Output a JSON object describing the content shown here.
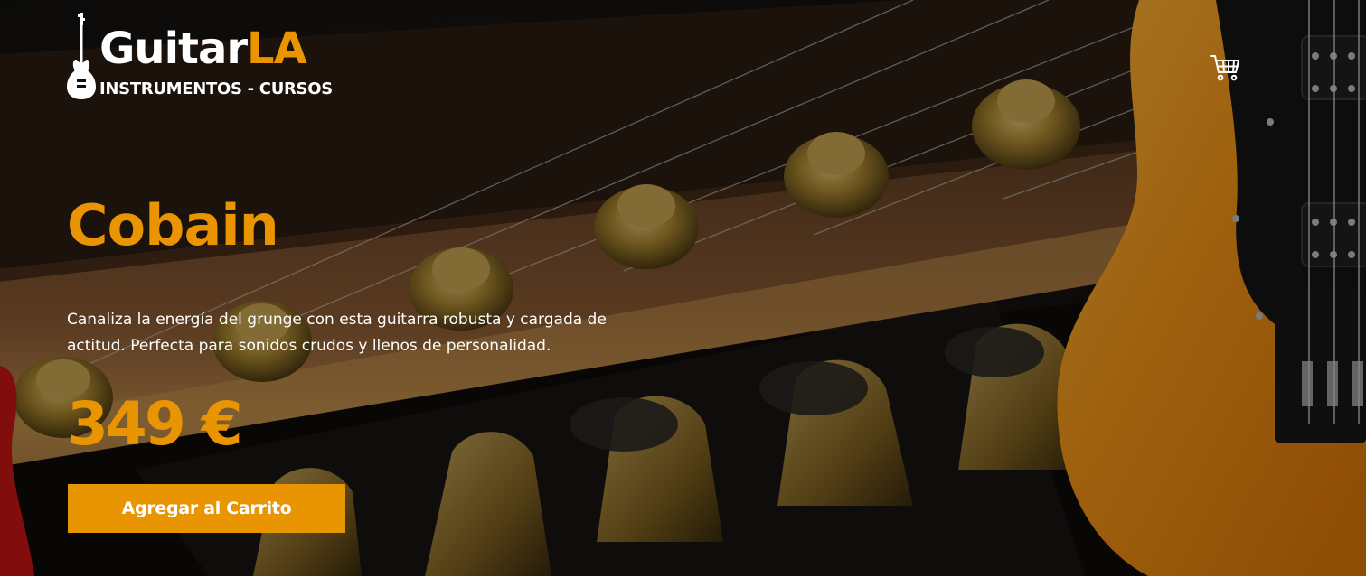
{
  "header": {
    "logo": {
      "title_main": "Guitar",
      "title_accent": "LA",
      "subtitle": "INSTRUMENTOS - CURSOS",
      "icon": "guitar-icon"
    },
    "cart": {
      "icon": "shopping-cart-icon"
    }
  },
  "hero": {
    "background": "guitar-headstock-photo",
    "product": {
      "name": "Cobain",
      "description": "Canaliza la energía del grunge con esta guitarra robusta y cargada de actitud. Perfecta para sonidos crudos y llenos de personalidad.",
      "price": "349 €",
      "button_label": "Agregar al Carrito"
    }
  },
  "colors": {
    "accent": "#e99401",
    "text": "#ffffff",
    "background": "#0d0c0b"
  }
}
